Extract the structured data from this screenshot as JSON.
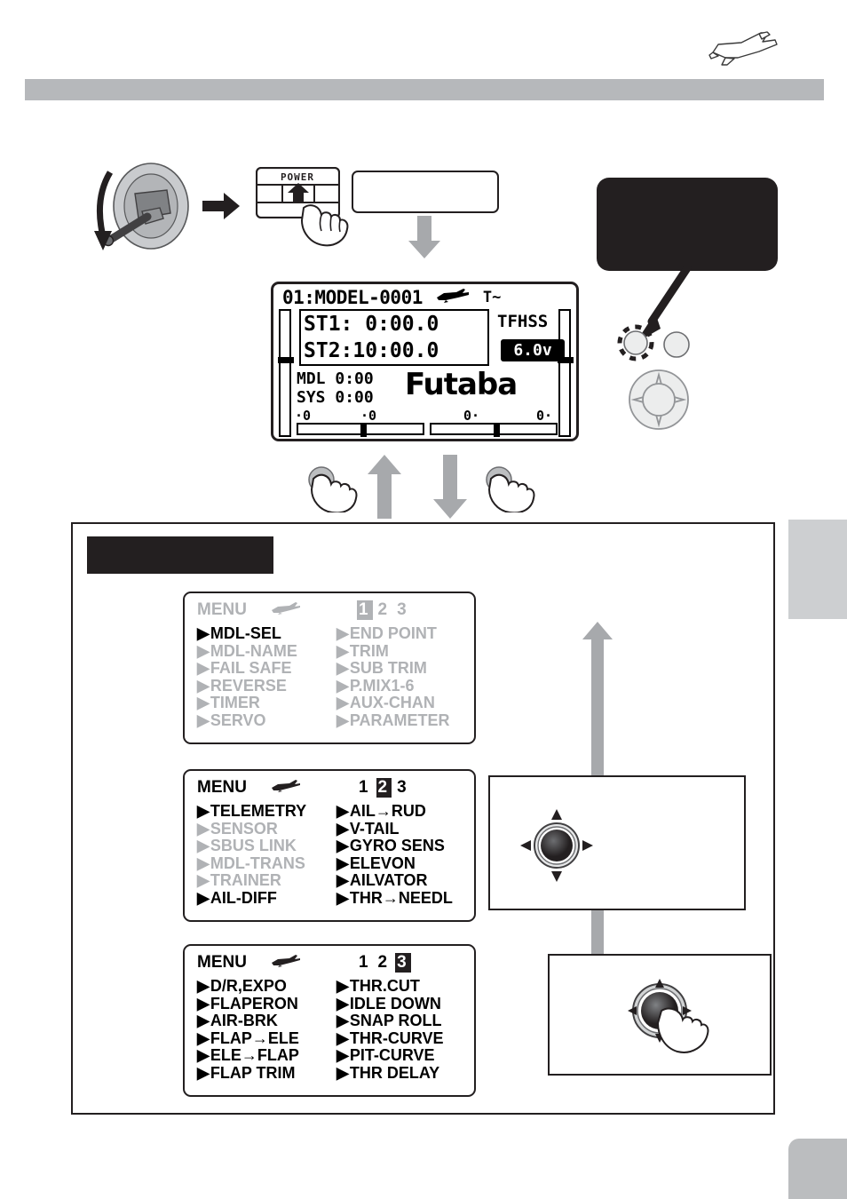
{
  "page": {
    "header_bar_color": "#b6b8bb",
    "plane_icon": "airplane-lineart-icon"
  },
  "top_flow": {
    "stick_icon": "throttle-stick-icon",
    "arrow_right_icon": "arrow-right-icon",
    "power_switch": {
      "label": "POWER",
      "icon": "power-switch-icon",
      "hand_icon": "hand-press-icon"
    },
    "caption_box": {
      "text": ""
    },
    "arrow_down_icon": "arrow-down-icon",
    "callout_box": {
      "text": ""
    },
    "callout_pointer_icon": "callout-pointer-line"
  },
  "transmitter_controls": {
    "end_button_icon": "end-button-icon",
    "mode_button_icon": "mode-button-icon",
    "nav_dial_icon": "four-way-dial-icon",
    "pointer_arrow_icon": "pointer-arrow-icon"
  },
  "lcd": {
    "model_line": "01:MODEL-0001",
    "plane_glyph": "airplane-glyph-icon",
    "antenna_glyph": "antenna-signal-icon",
    "timers": [
      {
        "label": "ST1:",
        "value": " 0:00.0"
      },
      {
        "label": "ST2:",
        "value": "10:00.0"
      }
    ],
    "system_mode": "TFHSS",
    "battery_voltage": "6.0v",
    "counters": [
      {
        "label": "MDL",
        "value": "0:00"
      },
      {
        "label": "SYS",
        "value": "0:00"
      }
    ],
    "brand": "Futaba",
    "trim_values": [
      "·0",
      "·0",
      "0·",
      "0·"
    ]
  },
  "lcd_controls": {
    "hand_left_icon": "hand-press-button-icon",
    "hand_right_icon": "hand-press-button-icon",
    "up_arrow_icon": "arrow-up-icon",
    "down_arrow_icon": "arrow-down-icon"
  },
  "bottom_panel": {
    "title_box": {
      "text": ""
    },
    "up_arrow_icon": "arrow-up-icon",
    "down_arrow_icon": "arrow-down-icon",
    "dial_box": {
      "dial_icon": "four-way-dial-icon",
      "arrows": [
        "▲",
        "▼",
        "◀",
        "▶"
      ]
    },
    "press_box": {
      "dial_icon": "four-way-dial-icon",
      "hand_icon": "hand-press-dial-icon"
    },
    "menus": [
      {
        "head_label": "MENU",
        "plane_glyph": "airplane-glyph-icon",
        "pages": [
          "1",
          "2",
          "3"
        ],
        "selected_page": 0,
        "style": "all-grey",
        "left_items": [
          {
            "label": "MDL-SEL",
            "state": "highlight-grey"
          },
          {
            "label": "MDL-NAME",
            "state": "grey"
          },
          {
            "label": "FAIL SAFE",
            "state": "grey"
          },
          {
            "label": "REVERSE",
            "state": "grey"
          },
          {
            "label": "TIMER",
            "state": "grey"
          },
          {
            "label": "SERVO",
            "state": "grey"
          }
        ],
        "right_items": [
          {
            "label": "END POINT",
            "state": "grey"
          },
          {
            "label": "TRIM",
            "state": "grey"
          },
          {
            "label": "SUB TRIM",
            "state": "grey"
          },
          {
            "label": "P.MIX1-6",
            "state": "grey"
          },
          {
            "label": "AUX-CHAN",
            "state": "grey"
          },
          {
            "label": "PARAMETER",
            "state": "grey"
          }
        ]
      },
      {
        "head_label": "MENU",
        "plane_glyph": "airplane-glyph-icon",
        "pages": [
          "1",
          "2",
          "3"
        ],
        "selected_page": 1,
        "style": "mixed",
        "left_items": [
          {
            "label": "TELEMETRY",
            "state": "highlight-grey"
          },
          {
            "label": "SENSOR",
            "state": "grey"
          },
          {
            "label": "SBUS LINK",
            "state": "grey"
          },
          {
            "label": "MDL-TRANS",
            "state": "grey"
          },
          {
            "label": "TRAINER",
            "state": "grey"
          },
          {
            "label": "AIL-DIFF",
            "state": "black"
          }
        ],
        "right_items": [
          {
            "label": "AIL→RUD",
            "state": "black"
          },
          {
            "label": "V-TAIL",
            "state": "black"
          },
          {
            "label": "GYRO SENS",
            "state": "black"
          },
          {
            "label": "ELEVON",
            "state": "black"
          },
          {
            "label": "AILVATOR",
            "state": "black"
          },
          {
            "label": "THR→NEEDL",
            "state": "black"
          }
        ]
      },
      {
        "head_label": "MENU",
        "plane_glyph": "airplane-glyph-icon",
        "pages": [
          "1",
          "2",
          "3"
        ],
        "selected_page": 2,
        "style": "all-black",
        "left_items": [
          {
            "label": "D/R,EXPO",
            "state": "highlight-black"
          },
          {
            "label": "FLAPERON",
            "state": "black"
          },
          {
            "label": "AIR-BRK",
            "state": "black"
          },
          {
            "label": "FLAP→ELE",
            "state": "black"
          },
          {
            "label": "ELE→FLAP",
            "state": "black"
          },
          {
            "label": "FLAP TRIM",
            "state": "black"
          }
        ],
        "right_items": [
          {
            "label": "THR.CUT",
            "state": "black"
          },
          {
            "label": "IDLE DOWN",
            "state": "black"
          },
          {
            "label": "SNAP ROLL",
            "state": "black"
          },
          {
            "label": "THR-CURVE",
            "state": "black"
          },
          {
            "label": "PIT-CURVE",
            "state": "black"
          },
          {
            "label": "THR DELAY",
            "state": "black"
          }
        ]
      }
    ]
  },
  "edge_tabs": [
    {
      "name": "page-tab-upper",
      "color": "#cdcfd1"
    },
    {
      "name": "page-tab-lower",
      "color": "#bbbdbf"
    }
  ]
}
